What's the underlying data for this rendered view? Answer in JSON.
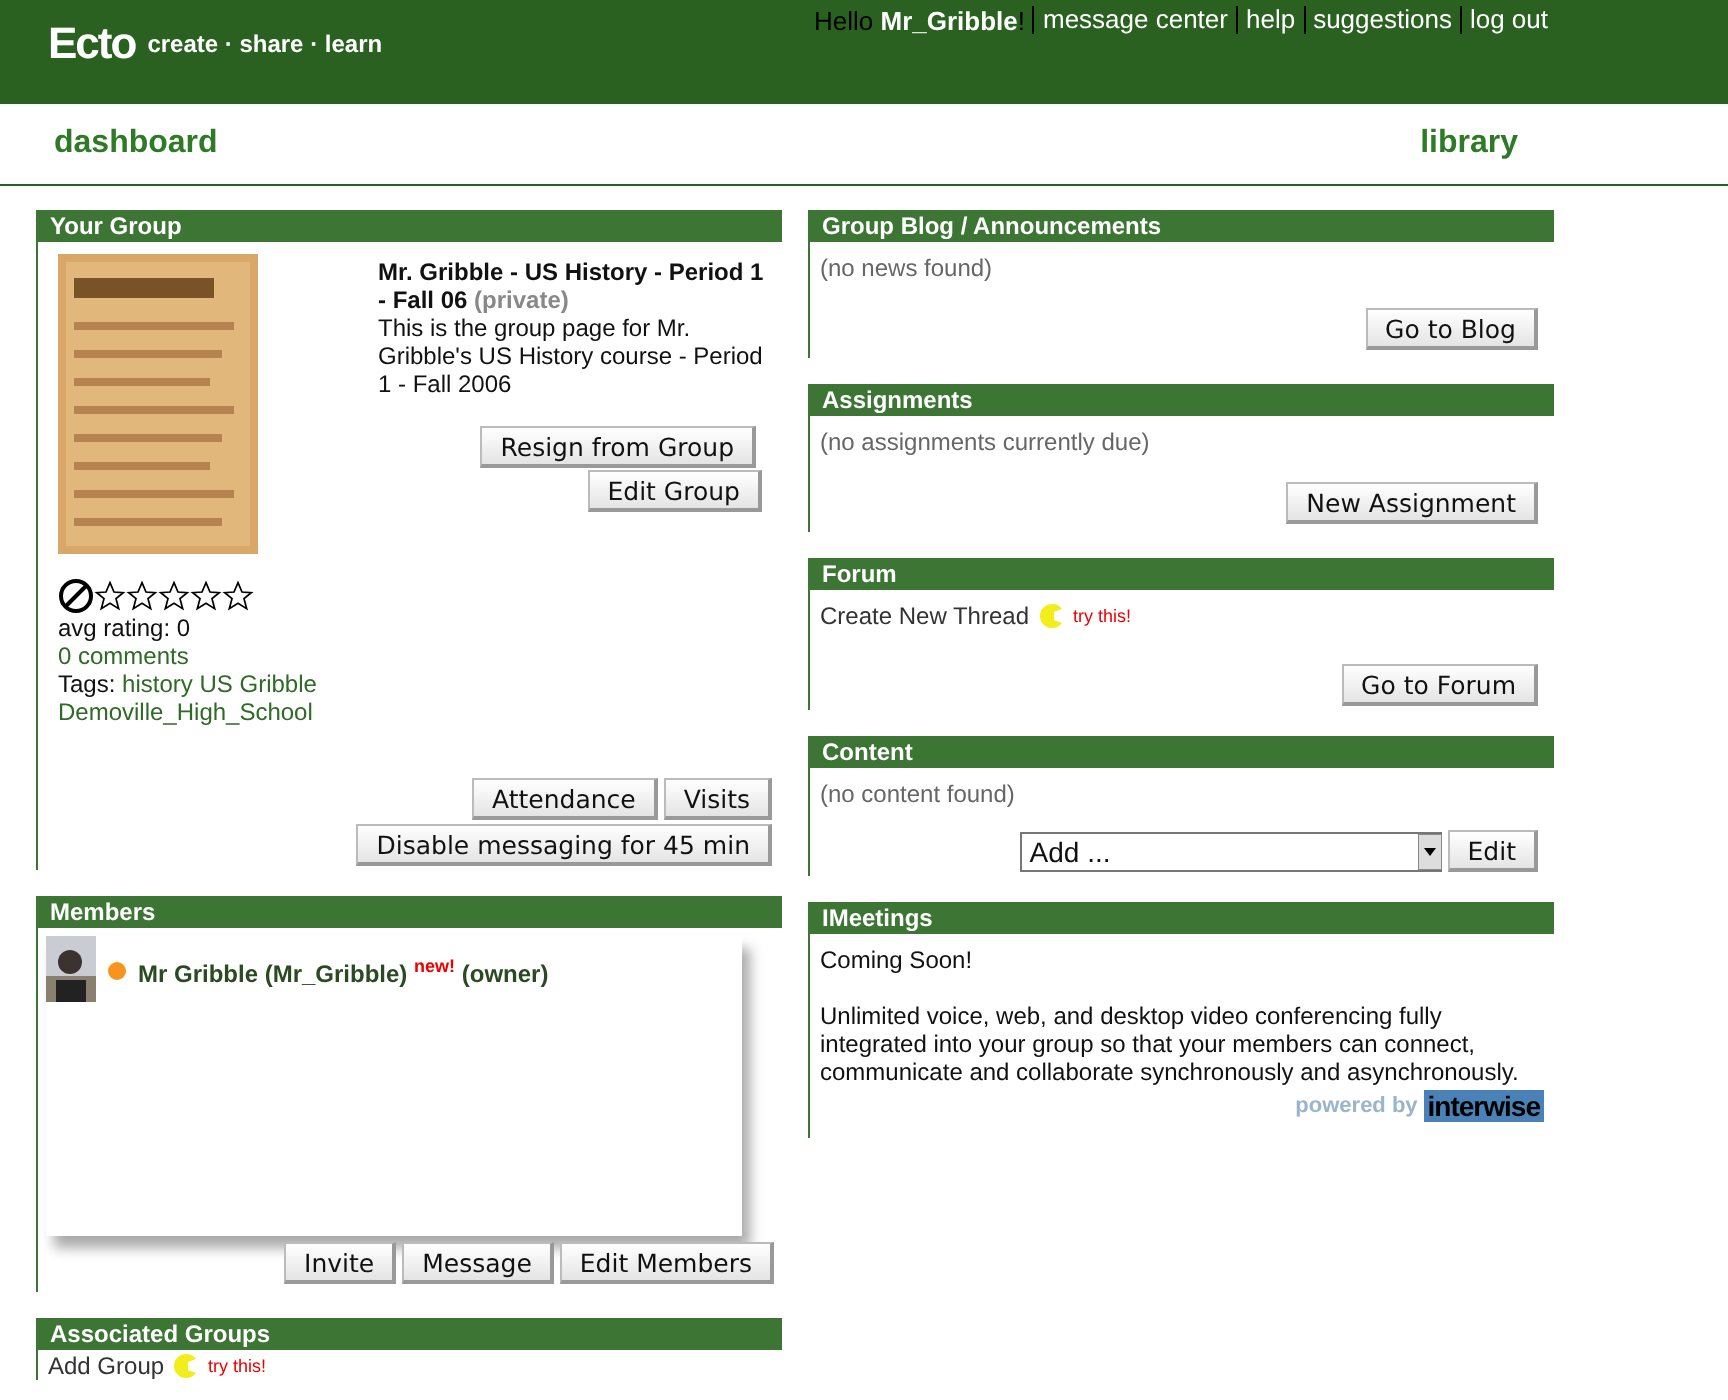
{
  "header": {
    "logo": "Ecto",
    "tagline": "create · share · learn",
    "greeting": "Hello **Mr_Gribble**!",
    "links": [
      "message center",
      "help",
      "suggestions",
      "log out"
    ]
  },
  "nav": {
    "left": "dashboard",
    "right": "library"
  },
  "your_group": {
    "title": "Your Group",
    "image": {
      "kind": "picture"
    },
    "name": "Mr. Gribble - US History - Period 1 - Fall 06",
    "privacy": "(private)",
    "description": "This is the group page for Mr. Gribble's US History course - Period 1 - Fall 2006",
    "buttons": [
      "Resign from Group",
      "Edit Group"
    ],
    "stars": 0,
    "rating": "avg rating: 0",
    "comments": "0 comments",
    "tags_label": "Tags:",
    "tags": [
      "history",
      "US",
      "Gribble",
      "Demoville_High_School"
    ],
    "bottom_buttons": [
      [
        "Attendance",
        "Visits"
      ],
      [
        "Disable messaging for 45 min"
      ]
    ]
  },
  "members": {
    "title": "Members",
    "list": [
      {
        "name": "Mr Gribble (Mr_Gribble)",
        "badge": "new!",
        "role": "(owner)",
        "color": "#f7941d"
      }
    ],
    "buttons": [
      "Invite",
      "Message",
      "Edit Members"
    ]
  },
  "associated_groups": {
    "title": "Associated Groups",
    "action": "Add Group",
    "hint": "try this!"
  },
  "blog": {
    "title": "Group Blog / Announcements",
    "empty": "(no news found)",
    "button": "Go to Blog"
  },
  "assignments": {
    "title": "Assignments",
    "empty": "(no assignments currently due)",
    "button": "New Assignment"
  },
  "forum": {
    "title": "Forum",
    "action": "Create New Thread",
    "hint": "try this!",
    "button": "Go to Forum"
  },
  "content": {
    "title": "Content",
    "empty": "(no content found)",
    "select": "Add ...",
    "button": "Edit"
  },
  "imeetings": {
    "title": "IMeetings",
    "status": "Coming Soon!",
    "description": "Unlimited voice, web, and desktop video conferencing fully integrated into your group so that your members can connect, communicate and collaborate synchronously and asynchronously.",
    "powered": "powered by",
    "brand": "interwise"
  }
}
